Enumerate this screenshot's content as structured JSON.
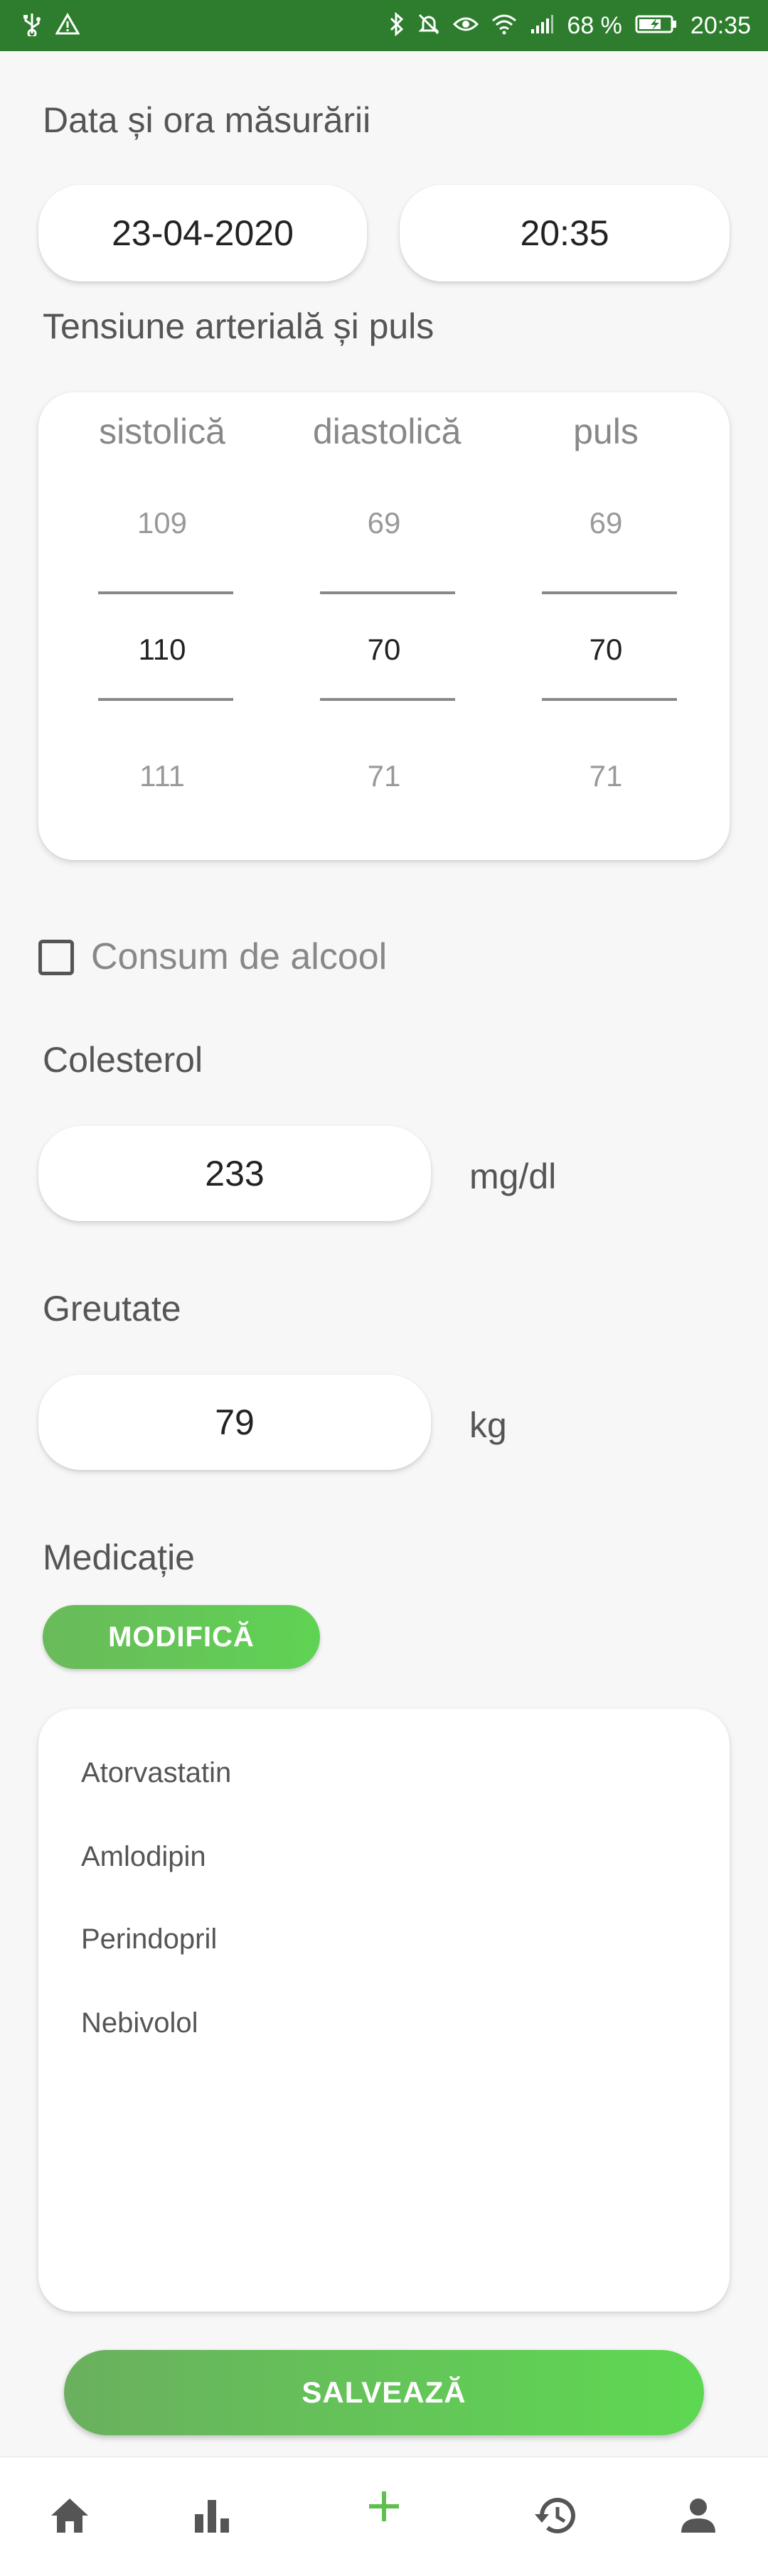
{
  "status_bar": {
    "battery_percent": "68 %",
    "time": "20:35",
    "left_icons": [
      "usb-icon",
      "warning-icon"
    ],
    "right_icons": [
      "bluetooth-icon",
      "mute-icon",
      "eye-icon",
      "wifi-icon",
      "signal-icon",
      "battery-icon"
    ]
  },
  "datetime_section": {
    "label": "Data și ora măsurării",
    "date": "23-04-2020",
    "time": "20:35"
  },
  "bp_section": {
    "label": "Tensiune arterială și puls",
    "columns": [
      {
        "header": "sistolică",
        "prev": "109",
        "selected": "110",
        "next": "111"
      },
      {
        "header": "diastolică",
        "prev": "69",
        "selected": "70",
        "next": "71"
      },
      {
        "header": "puls",
        "prev": "69",
        "selected": "70",
        "next": "71"
      }
    ]
  },
  "alcohol": {
    "label": "Consum de alcool",
    "checked": false
  },
  "cholesterol": {
    "label": "Colesterol",
    "value": "233",
    "unit": "mg/dl"
  },
  "weight": {
    "label": "Greutate",
    "value": "79",
    "unit": "kg"
  },
  "medication": {
    "label": "Medicație",
    "modify_label": "MODIFICĂ",
    "items": [
      "Atorvastatin",
      "Amlodipin",
      "Perindopril",
      "Nebivolol"
    ]
  },
  "save_label": "SALVEAZĂ",
  "bottom_nav": {
    "items": [
      "home-icon",
      "chart-icon",
      "add-icon",
      "history-icon",
      "profile-icon"
    ],
    "active": "add-icon"
  },
  "colors": {
    "status_bar": "#2e7d2e",
    "accent_green": "#5fd354",
    "nav_icon": "#555555"
  }
}
